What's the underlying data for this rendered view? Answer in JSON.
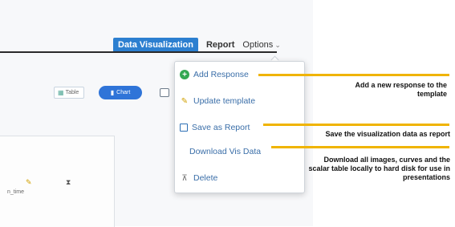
{
  "menu": {
    "tab_active": "Data Visualization",
    "report": "Report",
    "options": "Options"
  },
  "controls": {
    "table_label": "Table",
    "chart_label": "Chart"
  },
  "panel": {
    "label": "n_time"
  },
  "dropdown": {
    "items": [
      {
        "label": "Add Response",
        "icon": "plus-circle-icon"
      },
      {
        "label": "Update template",
        "icon": "pencil-icon"
      },
      {
        "label": "Save as Report",
        "icon": "save-icon"
      },
      {
        "label": "Download Vis Data",
        "icon": "none"
      },
      {
        "label": "Delete",
        "icon": "delete-icon"
      }
    ]
  },
  "annotations": {
    "add_response": "Add a new response to the template",
    "save_report": "Save the visualization data as report",
    "download": "Download all images, curves and the scalar table locally to hard disk for use in presentations"
  },
  "colors": {
    "accent_blue": "#2c7fd0",
    "callout_yellow": "#f0b400",
    "menu_text": "#3a6ea8",
    "add_green": "#34a853"
  }
}
